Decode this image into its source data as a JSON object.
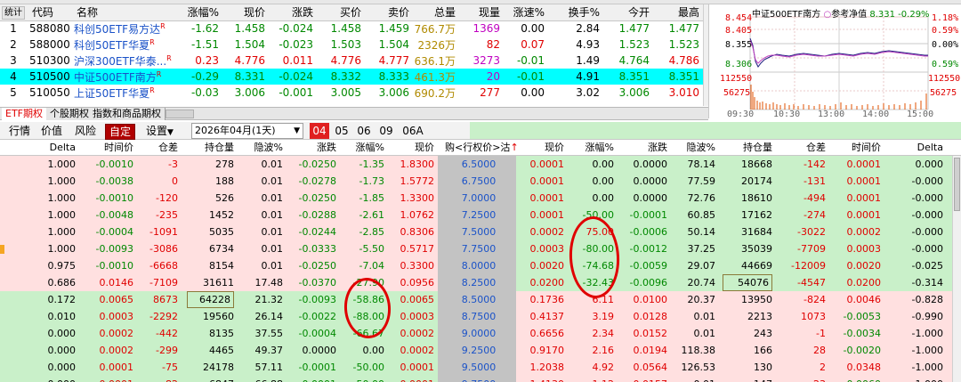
{
  "etf_table": {
    "columns": [
      "统计",
      "代码",
      "名称",
      "涨幅%",
      "现价",
      "涨跌",
      "买价",
      "卖价",
      "总量",
      "现量",
      "涨速%",
      "换手%",
      "今开",
      "最高"
    ],
    "rows": [
      {
        "idx": "1",
        "code": "588080",
        "name": "科创50ETF易方达",
        "tag": "R",
        "chg_pct": "-1.62",
        "price": "1.458",
        "chg": "-0.024",
        "bid": "1.458",
        "ask": "1.459",
        "volume": "766.7万",
        "cur_vol": "1369",
        "speed": "0.00",
        "turnover": "2.84",
        "open": "1.477",
        "high": "1.477"
      },
      {
        "idx": "2",
        "code": "588000",
        "name": "科创50ETF华夏",
        "tag": "R",
        "chg_pct": "-1.51",
        "price": "1.504",
        "chg": "-0.023",
        "bid": "1.503",
        "ask": "1.504",
        "volume": "2326万",
        "cur_vol": "82",
        "speed": "0.07",
        "turnover": "4.93",
        "open": "1.523",
        "high": "1.523"
      },
      {
        "idx": "3",
        "code": "510300",
        "name": "沪深300ETF华泰...",
        "tag": "R",
        "chg_pct": "0.23",
        "price": "4.776",
        "chg": "0.011",
        "bid": "4.776",
        "ask": "4.777",
        "volume": "636.1万",
        "cur_vol": "3273",
        "speed": "-0.01",
        "turnover": "1.49",
        "open": "4.764",
        "high": "4.786"
      },
      {
        "idx": "4",
        "code": "510500",
        "name": "中证500ETF南方",
        "tag": "R",
        "chg_pct": "-0.29",
        "price": "8.331",
        "chg": "-0.024",
        "bid": "8.332",
        "ask": "8.333",
        "volume": "461.3万",
        "cur_vol": "20",
        "speed": "-0.01",
        "turnover": "4.91",
        "open": "8.351",
        "high": "8.351"
      },
      {
        "idx": "5",
        "code": "510050",
        "name": "上证50ETF华夏",
        "tag": "R",
        "chg_pct": "-0.03",
        "price": "3.006",
        "chg": "-0.001",
        "bid": "3.005",
        "ask": "3.006",
        "volume": "690.2万",
        "cur_vol": "277",
        "speed": "0.00",
        "turnover": "3.02",
        "open": "3.006",
        "high": "3.010"
      }
    ]
  },
  "intraday": {
    "title": "中证500ETF南方",
    "legend": "参考净值",
    "quote": "8.331 -0.29%",
    "left_ticks": [
      "8.454",
      "8.405",
      "8.355",
      "8.306",
      "112550",
      "56275"
    ],
    "right_ticks": [
      "1.18%",
      "0.59%",
      "0.00%",
      "0.59%",
      "112550",
      "56275"
    ],
    "time_ticks": [
      "09:30",
      "10:30",
      "13:00",
      "14:00",
      "15:00"
    ]
  },
  "tabs": [
    "ETF期权",
    "个股期权",
    "指数和商品期权"
  ],
  "toolbar": {
    "items": [
      "行情",
      "价值",
      "风险",
      "自定",
      "设置"
    ],
    "month_select": "2026年04月(1天)",
    "months": [
      "04",
      "05",
      "06",
      "09",
      "06A"
    ]
  },
  "chain_header": {
    "left": [
      "Delta",
      "时间价",
      "仓差",
      "持仓量",
      "隐波%",
      "涨跌",
      "涨幅%",
      "现价"
    ],
    "strike": "购<行权价>沽",
    "right": [
      "现价",
      "涨幅%",
      "涨跌",
      "隐波%",
      "持仓量",
      "仓差",
      "时间价",
      "Delta"
    ]
  },
  "chain_rows": [
    {
      "call": {
        "delta": "1.000",
        "tv": "-0.0010",
        "oi_chg": "-3",
        "oi": "278",
        "iv": "0.01",
        "chg": "-0.0250",
        "chg_pct": "-1.35",
        "price": "1.8300"
      },
      "strike": "6.5000",
      "put": {
        "price": "0.0001",
        "chg_pct": "0.00",
        "chg": "0.0000",
        "iv": "78.14",
        "oi": "18668",
        "oi_chg": "-142",
        "tv": "0.0001",
        "delta": "0.000"
      }
    },
    {
      "call": {
        "delta": "1.000",
        "tv": "-0.0038",
        "oi_chg": "0",
        "oi": "188",
        "iv": "0.01",
        "chg": "-0.0278",
        "chg_pct": "-1.73",
        "price": "1.5772"
      },
      "strike": "6.7500",
      "put": {
        "price": "0.0001",
        "chg_pct": "0.00",
        "chg": "0.0000",
        "iv": "77.59",
        "oi": "20174",
        "oi_chg": "-131",
        "tv": "0.0001",
        "delta": "-0.000"
      }
    },
    {
      "call": {
        "delta": "1.000",
        "tv": "-0.0010",
        "oi_chg": "-120",
        "oi": "526",
        "iv": "0.01",
        "chg": "-0.0250",
        "chg_pct": "-1.85",
        "price": "1.3300"
      },
      "strike": "7.0000",
      "put": {
        "price": "0.0001",
        "chg_pct": "0.00",
        "chg": "0.0000",
        "iv": "72.76",
        "oi": "18610",
        "oi_chg": "-494",
        "tv": "0.0001",
        "delta": "-0.000"
      }
    },
    {
      "call": {
        "delta": "1.000",
        "tv": "-0.0048",
        "oi_chg": "-235",
        "oi": "1452",
        "iv": "0.01",
        "chg": "-0.0288",
        "chg_pct": "-2.61",
        "price": "1.0762"
      },
      "strike": "7.2500",
      "put": {
        "price": "0.0001",
        "chg_pct": "-50.00",
        "chg": "-0.0001",
        "iv": "60.85",
        "oi": "17162",
        "oi_chg": "-274",
        "tv": "0.0001",
        "delta": "-0.000"
      }
    },
    {
      "call": {
        "delta": "1.000",
        "tv": "-0.0004",
        "oi_chg": "-1091",
        "oi": "5035",
        "iv": "0.01",
        "chg": "-0.0244",
        "chg_pct": "-2.85",
        "price": "0.8306"
      },
      "strike": "7.5000",
      "put": {
        "price": "0.0002",
        "chg_pct": "75.00",
        "chg": "-0.0006",
        "iv": "50.14",
        "oi": "31684",
        "oi_chg": "-3022",
        "tv": "0.0002",
        "delta": "-0.000"
      }
    },
    {
      "call": {
        "delta": "1.000",
        "tv": "-0.0093",
        "oi_chg": "-3086",
        "oi": "6734",
        "iv": "0.01",
        "chg": "-0.0333",
        "chg_pct": "-5.50",
        "price": "0.5717"
      },
      "strike": "7.7500",
      "put": {
        "price": "0.0003",
        "chg_pct": "-80.00",
        "chg": "-0.0012",
        "iv": "37.25",
        "oi": "35039",
        "oi_chg": "-7709",
        "tv": "0.0003",
        "delta": "-0.000"
      }
    },
    {
      "call": {
        "delta": "0.975",
        "tv": "-0.0010",
        "oi_chg": "-6668",
        "oi": "8154",
        "iv": "0.01",
        "chg": "-0.0250",
        "chg_pct": "-7.04",
        "price": "0.3300"
      },
      "strike": "8.0000",
      "put": {
        "price": "0.0020",
        "chg_pct": "-74.68",
        "chg": "-0.0059",
        "iv": "29.07",
        "oi": "44669",
        "oi_chg": "-12009",
        "tv": "0.0020",
        "delta": "-0.025"
      }
    },
    {
      "call": {
        "delta": "0.686",
        "tv": "0.0146",
        "oi_chg": "-7109",
        "oi": "31611",
        "iv": "17.48",
        "chg": "-0.0370",
        "chg_pct": "-27.90",
        "price": "0.0956"
      },
      "strike": "8.2500",
      "put": {
        "price": "0.0200",
        "chg_pct": "-32.43",
        "chg": "-0.0096",
        "iv": "20.74",
        "oi": "54076",
        "oi_chg": "-4547",
        "tv": "0.0200",
        "delta": "-0.314"
      }
    },
    {
      "call": {
        "delta": "0.172",
        "tv": "0.0065",
        "oi_chg": "8673",
        "oi": "64228",
        "iv": "21.32",
        "chg": "-0.0093",
        "chg_pct": "-58.86",
        "price": "0.0065"
      },
      "strike": "8.5000",
      "put": {
        "price": "0.1736",
        "chg_pct": "6.11",
        "chg": "0.0100",
        "iv": "20.37",
        "oi": "13950",
        "oi_chg": "-824",
        "tv": "0.0046",
        "delta": "-0.828"
      }
    },
    {
      "call": {
        "delta": "0.010",
        "tv": "0.0003",
        "oi_chg": "-2292",
        "oi": "19560",
        "iv": "26.14",
        "chg": "-0.0022",
        "chg_pct": "-88.00",
        "price": "0.0003"
      },
      "strike": "8.7500",
      "put": {
        "price": "0.4137",
        "chg_pct": "3.19",
        "chg": "0.0128",
        "iv": "0.01",
        "oi": "2213",
        "oi_chg": "1073",
        "tv": "-0.0053",
        "delta": "-0.990"
      }
    },
    {
      "call": {
        "delta": "0.000",
        "tv": "0.0002",
        "oi_chg": "-442",
        "oi": "8135",
        "iv": "37.55",
        "chg": "-0.0004",
        "chg_pct": "-66.67",
        "price": "0.0002"
      },
      "strike": "9.0000",
      "put": {
        "price": "0.6656",
        "chg_pct": "2.34",
        "chg": "0.0152",
        "iv": "0.01",
        "oi": "243",
        "oi_chg": "-1",
        "tv": "-0.0034",
        "delta": "-1.000"
      }
    },
    {
      "call": {
        "delta": "0.000",
        "tv": "0.0002",
        "oi_chg": "-299",
        "oi": "4465",
        "iv": "49.37",
        "chg": "0.0000",
        "chg_pct": "0.00",
        "price": "0.0002"
      },
      "strike": "9.2500",
      "put": {
        "price": "0.9170",
        "chg_pct": "2.16",
        "chg": "0.0194",
        "iv": "118.38",
        "oi": "166",
        "oi_chg": "28",
        "tv": "-0.0020",
        "delta": "-1.000"
      }
    },
    {
      "call": {
        "delta": "0.000",
        "tv": "0.0001",
        "oi_chg": "-75",
        "oi": "24178",
        "iv": "57.11",
        "chg": "-0.0001",
        "chg_pct": "-50.00",
        "price": "0.0001"
      },
      "strike": "9.5000",
      "put": {
        "price": "1.2038",
        "chg_pct": "4.92",
        "chg": "0.0564",
        "iv": "126.53",
        "oi": "130",
        "oi_chg": "2",
        "tv": "0.0348",
        "delta": "-1.000"
      }
    },
    {
      "call": {
        "delta": "0.000",
        "tv": "0.0001",
        "oi_chg": "82",
        "oi": "6847",
        "iv": "66.88",
        "chg": "-0.0001",
        "chg_pct": "-50.00",
        "price": "0.0001"
      },
      "strike": "9.7500",
      "put": {
        "price": "1.4130",
        "chg_pct": "1.12",
        "chg": "0.0157",
        "iv": "0.01",
        "oi": "147",
        "oi_chg": "23",
        "tv": "-0.0060",
        "delta": "-1.000"
      }
    }
  ],
  "colors": {
    "call_itm_bg": "#ffe0e0",
    "call_otm_bg": "#c9f0c9",
    "put_otm_bg": "#c9f0c9",
    "put_itm_bg": "#ffe0e0",
    "strike_bg": "#c3c3c3",
    "strike_text": "#1a52c8",
    "highlight_circle": "#e00000"
  }
}
